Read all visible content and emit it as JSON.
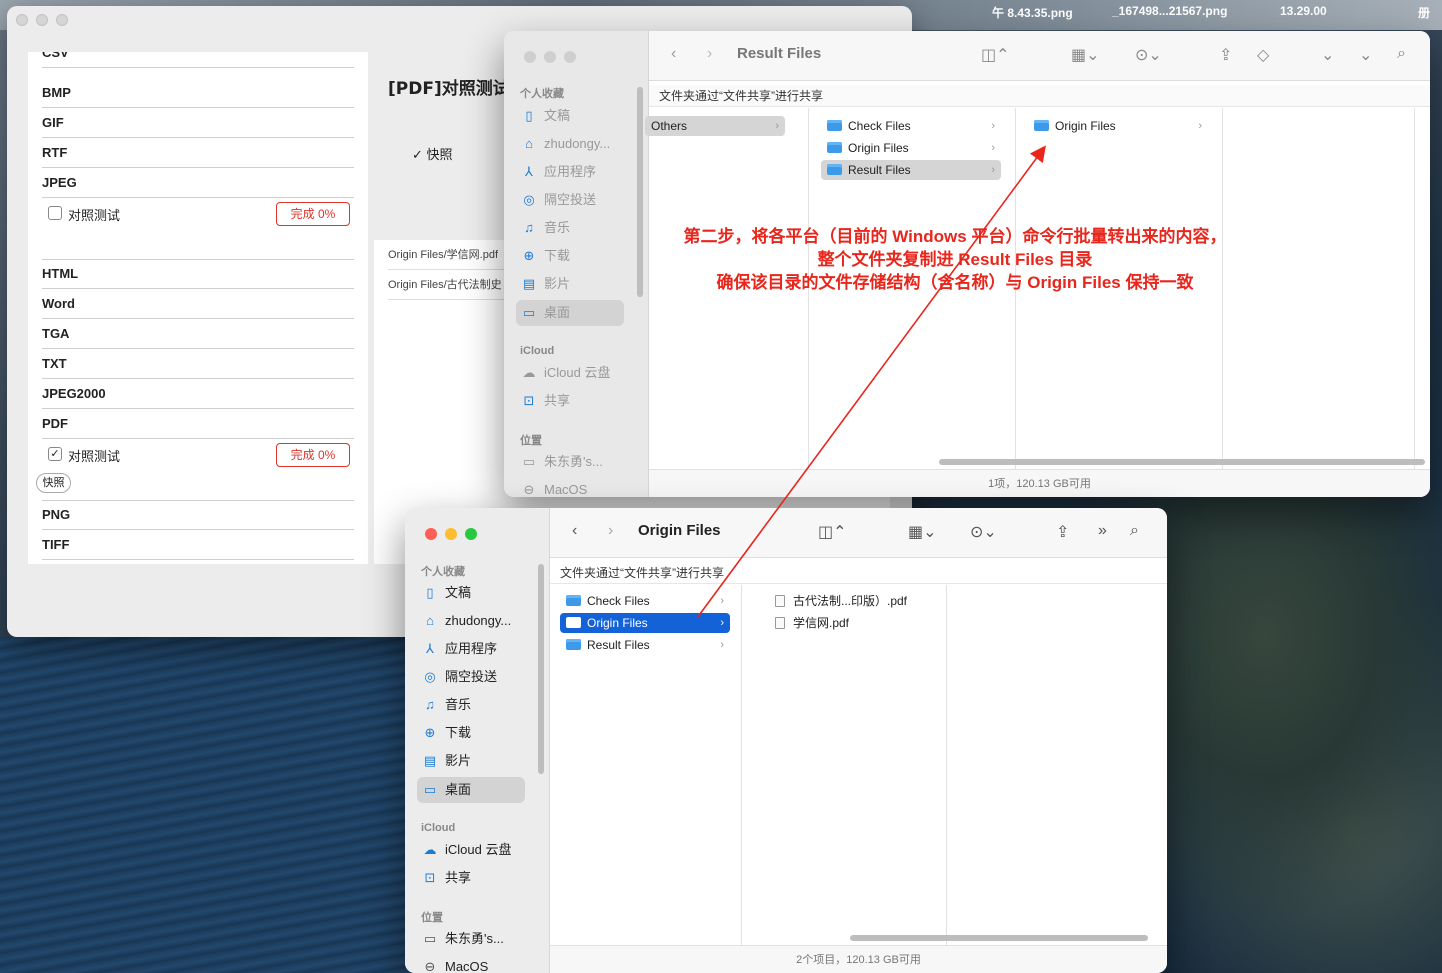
{
  "desktop": {
    "top_labels": [
      "午 8.43.35.png",
      "_167498...21567.png",
      "13.29.00",
      "册"
    ]
  },
  "app": {
    "list_rows": [
      {
        "label": "CSV"
      },
      {
        "label": "BMP"
      },
      {
        "label": "GIF"
      },
      {
        "label": "RTF"
      },
      {
        "label": "JPEG"
      },
      {
        "label": "HTML"
      },
      {
        "label": "Word"
      },
      {
        "label": "TGA"
      },
      {
        "label": "TXT"
      },
      {
        "label": "JPEG2000"
      },
      {
        "label": "PDF"
      },
      {
        "label": "PNG"
      },
      {
        "label": "TIFF"
      }
    ],
    "compare_label": "对照测试",
    "done_label": "完成 0%",
    "snapshot_btn": "快照",
    "panel_title": "[PDF]对照测试",
    "snapshot_check": "快照",
    "files": [
      "Origin Files/学信网.pdf",
      "Origin Files/古代法制史"
    ]
  },
  "finder_back": {
    "title": "Result Files",
    "path": "文件夹通过“文件共享”进行共享",
    "sidebar_head_fav": "个人收藏",
    "sidebar": [
      "文稿",
      "zhudongy...",
      "应用程序",
      "隔空投送",
      "音乐",
      "下载",
      "影片",
      "桌面"
    ],
    "icloud_head": "iCloud",
    "icloud": [
      "iCloud 云盘",
      "共享"
    ],
    "loc_head": "位置",
    "loc": [
      "朱东勇's...",
      "MacOS"
    ],
    "col1": [
      "Others"
    ],
    "col2": [
      "Check Files",
      "Origin Files",
      "Result Files"
    ],
    "col3": [
      "Origin Files"
    ],
    "status": "1项，120.13 GB可用"
  },
  "finder_front": {
    "title": "Origin Files",
    "path": "文件夹通过“文件共享”进行共享",
    "sidebar_head_fav": "个人收藏",
    "sidebar": [
      "文稿",
      "zhudongy...",
      "应用程序",
      "隔空投送",
      "音乐",
      "下载",
      "影片",
      "桌面"
    ],
    "icloud_head": "iCloud",
    "icloud": [
      "iCloud 云盘",
      "共享"
    ],
    "loc_head": "位置",
    "loc": [
      "朱东勇's...",
      "MacOS"
    ],
    "col1": [
      "Check Files",
      "Origin Files",
      "Result Files"
    ],
    "col2": [
      "古代法制...印版）.pdf",
      "学信网.pdf"
    ],
    "status": "2个项目，120.13 GB可用"
  },
  "annotation": {
    "line1": "第二步，将各平台（目前的 Windows 平台）命令行批量转出来的内容，",
    "line2": "整个文件夹复制进 Result Files 目录",
    "line3": "确保该目录的文件存储结构（含名称）与 Origin Files 保持一致",
    "color": "#e8261c"
  }
}
